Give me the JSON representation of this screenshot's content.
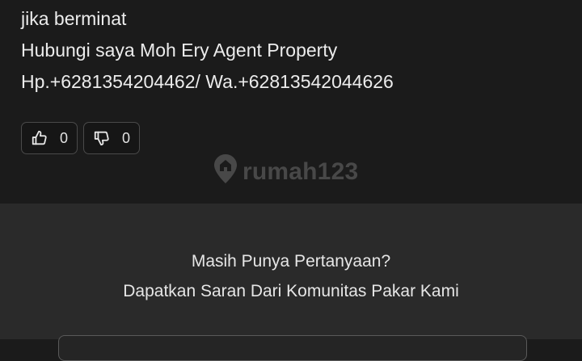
{
  "answer": {
    "lines": [
      "jika berminat",
      "Hubungi saya Moh Ery Agent Property",
      "Hp.+6281354204462/ Wa.+62813542044626"
    ]
  },
  "votes": {
    "like_count": "0",
    "dislike_count": "0"
  },
  "watermark": {
    "text": "rumah123"
  },
  "cta": {
    "question": "Masih Punya Pertanyaan?",
    "subtitle": "Dapatkan Saran Dari Komunitas Pakar Kami"
  },
  "colors": {
    "background": "#1b1b1b",
    "cta_background": "#2a2a2a",
    "text": "#e9e9e9"
  }
}
